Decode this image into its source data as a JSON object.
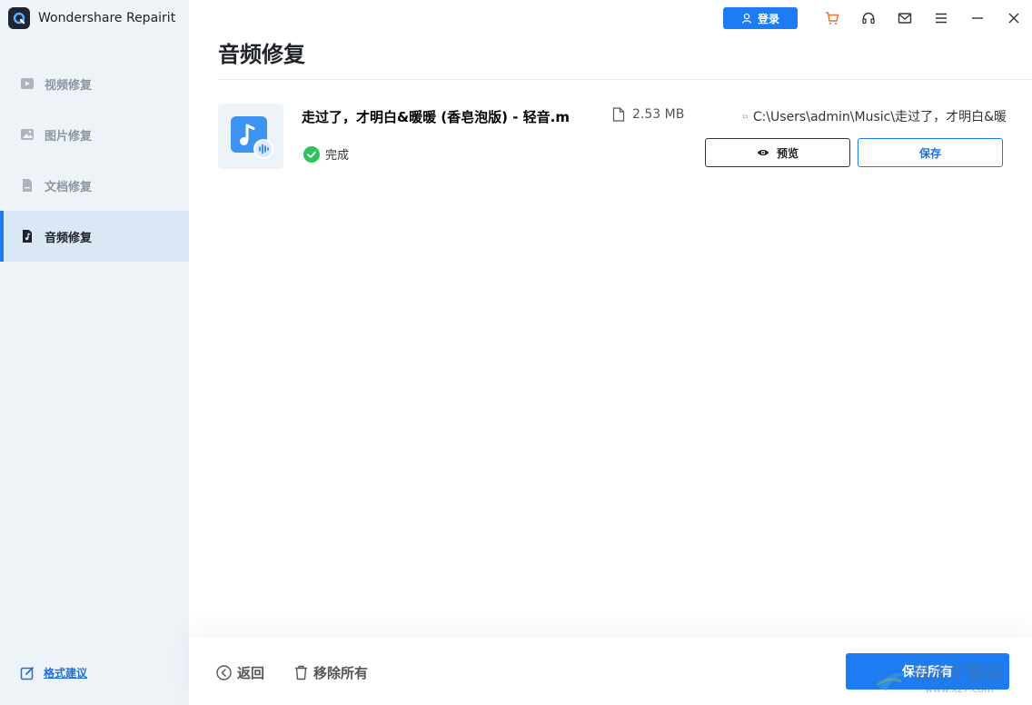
{
  "app": {
    "name": "Wondershare Repairit"
  },
  "titlebar": {
    "login_label": "登录",
    "icons": [
      "cart-icon",
      "headset-icon",
      "mail-icon",
      "menu-icon",
      "minimize-icon",
      "close-icon"
    ],
    "cart_color": "#e8742a"
  },
  "sidebar": {
    "items": [
      {
        "label": "视频修复",
        "icon": "video-icon",
        "active": false
      },
      {
        "label": "图片修复",
        "icon": "image-icon",
        "active": false
      },
      {
        "label": "文档修复",
        "icon": "document-icon",
        "active": false
      },
      {
        "label": "音频修复",
        "icon": "music-icon",
        "active": true
      }
    ],
    "feedback_label": "格式建议"
  },
  "main": {
    "title": "音频修复",
    "files": [
      {
        "name": "走过了，才明白&暖暖 (香皂泡版) - 轻音.m",
        "size": "2.53  MB",
        "path": "C:\\Users\\admin\\Music\\走过了，才明白&暖",
        "status": "完成",
        "preview_label": "预览",
        "save_label": "保存"
      }
    ]
  },
  "footer": {
    "back_label": "返回",
    "remove_all_label": "移除所有",
    "save_all_label": "保存所有"
  },
  "watermark": {
    "text": "极光下载站",
    "url": "www.xz7.com"
  },
  "colors": {
    "accent": "#1d7cf2",
    "success": "#2fc25b",
    "sidebar_bg": "#eef3f8",
    "active_bg": "#dae7f5"
  }
}
